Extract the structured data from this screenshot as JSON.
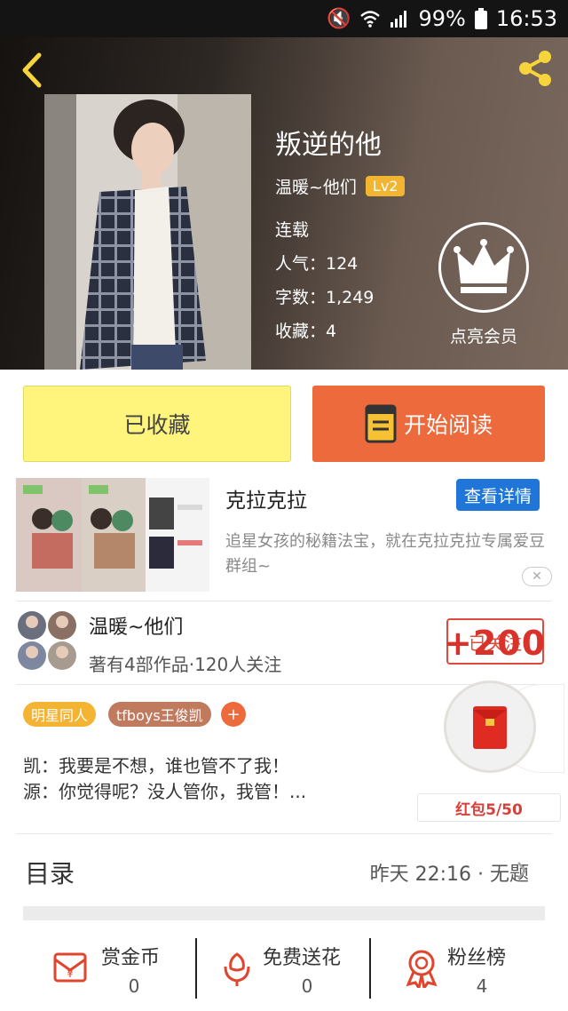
{
  "status_bar": {
    "battery": "99%",
    "time": "16:53"
  },
  "book": {
    "title": "叛逆的他",
    "author": "温暖~他们",
    "author_level": "Lv2",
    "status": "连载",
    "popularity": "人气：124",
    "word_count": "字数：1,249",
    "favorites": "收藏：4"
  },
  "vip": {
    "label": "点亮会员"
  },
  "actions": {
    "collected_label": "已收藏",
    "read_label": "开始阅读"
  },
  "ad": {
    "title": "克拉克拉",
    "detail_button": "查看详情",
    "description": "追星女孩的秘籍法宝，就在克拉克拉专属爱豆群组~",
    "close": "✕"
  },
  "author_section": {
    "name": "温暖~他们",
    "meta": "著有4部作品·120人关注",
    "follow_button": "已关注",
    "bonus": "+200"
  },
  "tags": {
    "items": [
      "明星同人",
      "tfboys王俊凯"
    ],
    "add": "+"
  },
  "intro": {
    "line1": "凯：我要是不想，谁也管不了我！",
    "line2": "源：你觉得呢？没人管你，我管！..."
  },
  "red_packet": {
    "label": "红包5/50"
  },
  "toc": {
    "title": "目录",
    "latest": "昨天 22:16 · 无题"
  },
  "bottom": {
    "reward": {
      "label": "赏金币",
      "count": "0"
    },
    "flowers": {
      "label": "免费送花",
      "count": "0"
    },
    "fans": {
      "label": "粉丝榜",
      "count": "4"
    }
  },
  "colors": {
    "accent_orange": "#ec6a3b",
    "collected_yellow": "#fff47c",
    "level_badge": "#f2b531",
    "ad_blue": "#1f76d8",
    "packet_red": "#d6403a"
  }
}
